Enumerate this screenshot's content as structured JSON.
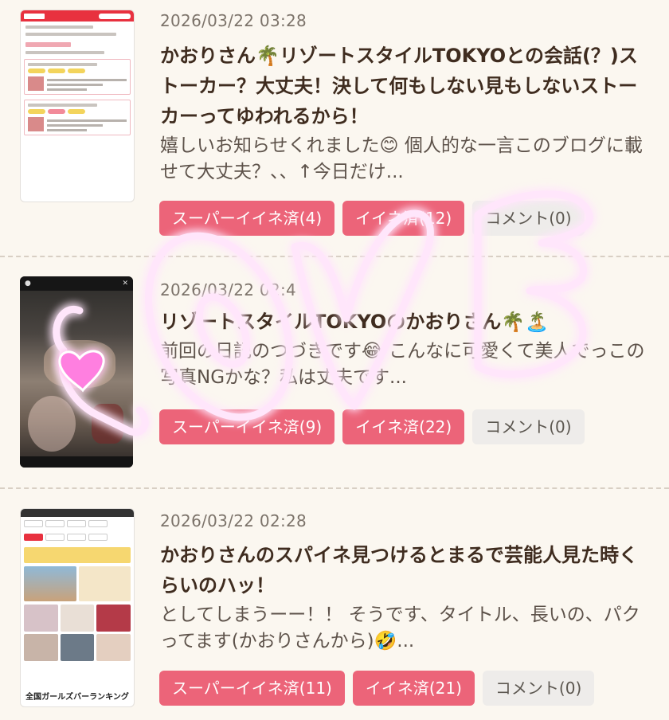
{
  "posts": [
    {
      "date": "2026/03/22 03:28",
      "title": "かおりさん🌴リゾートスタイルTOKYOとの会話(？)ストーカー？大丈夫！決して何もしない見もしないストーカーってゆわれるから！",
      "excerpt": "嬉しいお知らせくれました😊 個人的な一言このブログに載せて大丈夫？、、↑今日だけ...",
      "buttons": {
        "super_like": "スーパーイイネ済(4)",
        "like": "イイネ済(12)",
        "comment": "コメント(0)"
      }
    },
    {
      "date": "2026/03/22 02:4",
      "title": "リゾートスタイルTOKYOのかおりさん🌴🏝️",
      "excerpt": "前回の日記のつづきです😂 こんなに可愛くて美人でっこの写真NGかな？私は丈夫です...",
      "buttons": {
        "super_like": "スーパーイイネ済(9)",
        "like": "イイネ済(22)",
        "comment": "コメント(0)"
      }
    },
    {
      "date": "2026/03/22 02:28",
      "title": "かおりさんのスパイネ見つけるとまるで芸能人見た時くらいのハッ！",
      "excerpt": " としてしまうーー！！ そうです、タイトル、長いの、パクってます(かおりさんから)🤣...",
      "buttons": {
        "super_like": "スーパーイイネ済(11)",
        "like": "イイネ済(21)",
        "comment": "コメント(0)"
      }
    }
  ],
  "thumb3_caption": "全国ガールズバーランキング",
  "overlay": {
    "sticker": "LOVE",
    "color": "#ff7fe0"
  },
  "colors": {
    "background": "#fbf7f0",
    "accent_pink": "#ec6479",
    "comment_gray": "#eeecea",
    "title_brown": "#3f2c1f"
  }
}
